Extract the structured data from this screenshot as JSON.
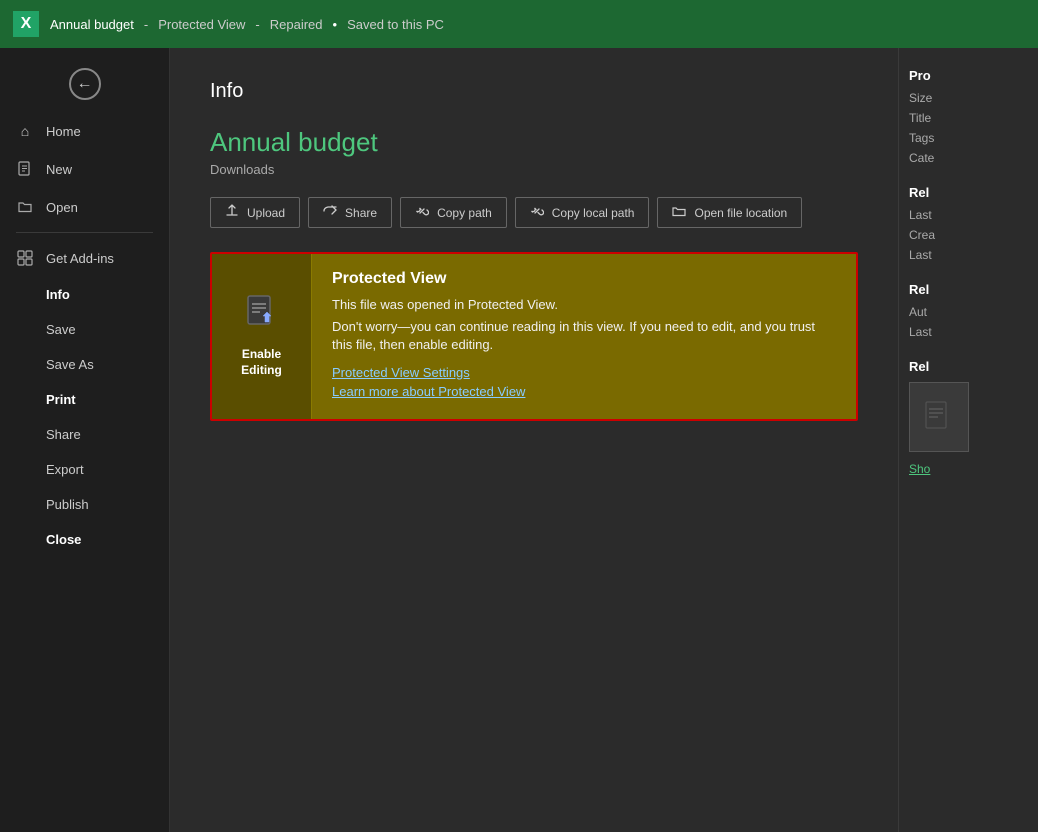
{
  "titlebar": {
    "app_name": "Annual budget",
    "separator1": " - ",
    "protected_view": "Protected View",
    "separator2": " - ",
    "repaired": "Repaired",
    "bullet": " • ",
    "saved": "Saved to this PC"
  },
  "sidebar": {
    "back_label": "Back",
    "items": [
      {
        "id": "home",
        "label": "Home",
        "icon": "⌂",
        "has_icon": true
      },
      {
        "id": "new",
        "label": "New",
        "icon": "☐",
        "has_icon": true
      },
      {
        "id": "open",
        "label": "Open",
        "icon": "📁",
        "has_icon": true
      },
      {
        "id": "get-add-ins",
        "label": "Get Add-ins",
        "icon": "⊞",
        "has_icon": true
      },
      {
        "id": "info",
        "label": "Info",
        "has_icon": false
      },
      {
        "id": "save",
        "label": "Save",
        "has_icon": false
      },
      {
        "id": "save-as",
        "label": "Save As",
        "has_icon": false
      },
      {
        "id": "print",
        "label": "Print",
        "bold": true,
        "has_icon": false
      },
      {
        "id": "share",
        "label": "Share",
        "has_icon": false
      },
      {
        "id": "export",
        "label": "Export",
        "has_icon": false
      },
      {
        "id": "publish",
        "label": "Publish",
        "has_icon": false
      },
      {
        "id": "close",
        "label": "Close",
        "bold": true,
        "has_icon": false
      }
    ]
  },
  "content": {
    "page_title": "Info",
    "file_title": "Annual budget",
    "file_location": "Downloads",
    "action_buttons": [
      {
        "id": "upload",
        "label": "Upload",
        "icon": "⬆"
      },
      {
        "id": "share",
        "label": "Share",
        "icon": "↗"
      },
      {
        "id": "copy-path",
        "label": "Copy path",
        "icon": "🔗"
      },
      {
        "id": "copy-local-path",
        "label": "Copy local path",
        "icon": "🔗"
      },
      {
        "id": "open-file-location",
        "label": "Open file location",
        "icon": "📂"
      }
    ],
    "banner": {
      "title": "Protected View",
      "enable_btn_label": "Enable\nEditing",
      "desc1": "This file was opened in Protected View.",
      "desc2": "Don't worry—you can continue reading in this view. If you need to edit, and you trust\nthis file, then enable editing.",
      "link1": "Protected View Settings",
      "link2": "Learn more about Protected View"
    }
  },
  "right_panel": {
    "properties_title": "Pro",
    "size_label": "Size",
    "title_label": "Title",
    "tags_label": "Tags",
    "categories_label": "Cate",
    "related_dates_title": "Rel",
    "last_modified_label": "Last",
    "created_label": "Crea",
    "last_printed_label": "Last",
    "related_people_title": "Rel",
    "author_label": "Aut",
    "last_modified_by_label": "Last",
    "related_docs_title": "Rel",
    "show_all_link": "Sho"
  }
}
